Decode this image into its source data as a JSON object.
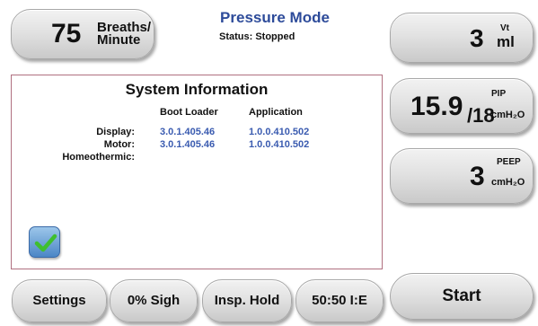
{
  "header": {
    "mode_title": "Pressure Mode",
    "status": "Status: Stopped"
  },
  "breaths": {
    "value": "75",
    "label_line1": "Breaths/",
    "label_line2": "Minute"
  },
  "vt": {
    "value": "3",
    "unit_top": "Vt",
    "unit_bottom": "ml"
  },
  "pip": {
    "value": "15.9",
    "slash_value": "/18",
    "unit_top": "PIP",
    "unit_bottom": "cmH₂O"
  },
  "peep": {
    "value": "3",
    "unit_top": "PEEP",
    "unit_bottom": "cmH₂O"
  },
  "system_info": {
    "title": "System Information",
    "columns": [
      "Boot Loader",
      "Application"
    ],
    "rows": [
      {
        "label": "Display:",
        "boot_loader": "3.0.1.405.46",
        "application": "1.0.0.410.502"
      },
      {
        "label": "Motor:",
        "boot_loader": "3.0.1.405.46",
        "application": "1.0.0.410.502"
      },
      {
        "label": "Homeothermic:",
        "boot_loader": "",
        "application": ""
      }
    ],
    "confirm_icon": "checkmark-icon"
  },
  "bottom_bar": {
    "settings": "Settings",
    "sigh": "0% Sigh",
    "insp_hold": "Insp. Hold",
    "ie_ratio": "50:50 I:E",
    "start": "Start"
  },
  "colors": {
    "accent_blue": "#2d4b9a",
    "value_blue": "#3a5bb0",
    "check_green": "#3fbf2f",
    "panel_border": "#b07080"
  }
}
